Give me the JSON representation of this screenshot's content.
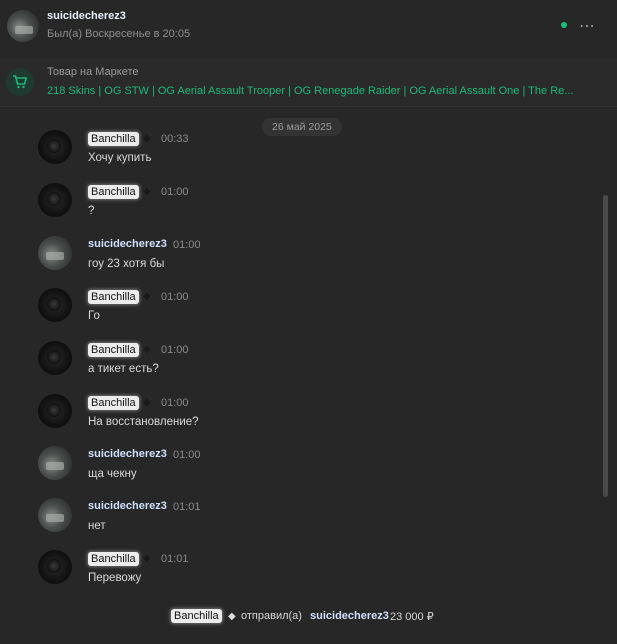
{
  "header": {
    "username": "suicidecherez3",
    "status": "Был(а) Воскресенье в 20:05",
    "more_icon": "⋯"
  },
  "market": {
    "label": "Товар на Маркете",
    "title": "218 Skins | OG STW | OG Aerial Assault Trooper | OG Renegade Raider | OG Aerial Assault One | The Re..."
  },
  "chat": {
    "date": "26 май 2025",
    "messages": [
      {
        "author": "Banchilla",
        "time": "00:33",
        "text": "Хочу купить"
      },
      {
        "author": "Banchilla",
        "time": "01:00",
        "text": "?"
      },
      {
        "author": "suicidecherez3",
        "time": "01:00",
        "text": "гоу 23 хотя бы"
      },
      {
        "author": "Banchilla",
        "time": "01:00",
        "text": "Го"
      },
      {
        "author": "Banchilla",
        "time": "01:00",
        "text": "а тикет есть?"
      },
      {
        "author": "Banchilla",
        "time": "01:00",
        "text": "На восстановление?"
      },
      {
        "author": "suicidecherez3",
        "time": "01:00",
        "text": "ща чекну"
      },
      {
        "author": "suicidecherez3",
        "time": "01:01",
        "text": "нет"
      },
      {
        "author": "Banchilla",
        "time": "01:01",
        "text": "Перевожу"
      }
    ],
    "transfer": {
      "sender": "Banchilla",
      "verb": "отправил(а)",
      "recipient": "suicidecherez3",
      "amount": "23 000 ₽"
    }
  },
  "colors": {
    "accent": "#1fb87a",
    "online": "#17c27a",
    "background": "#272727"
  }
}
